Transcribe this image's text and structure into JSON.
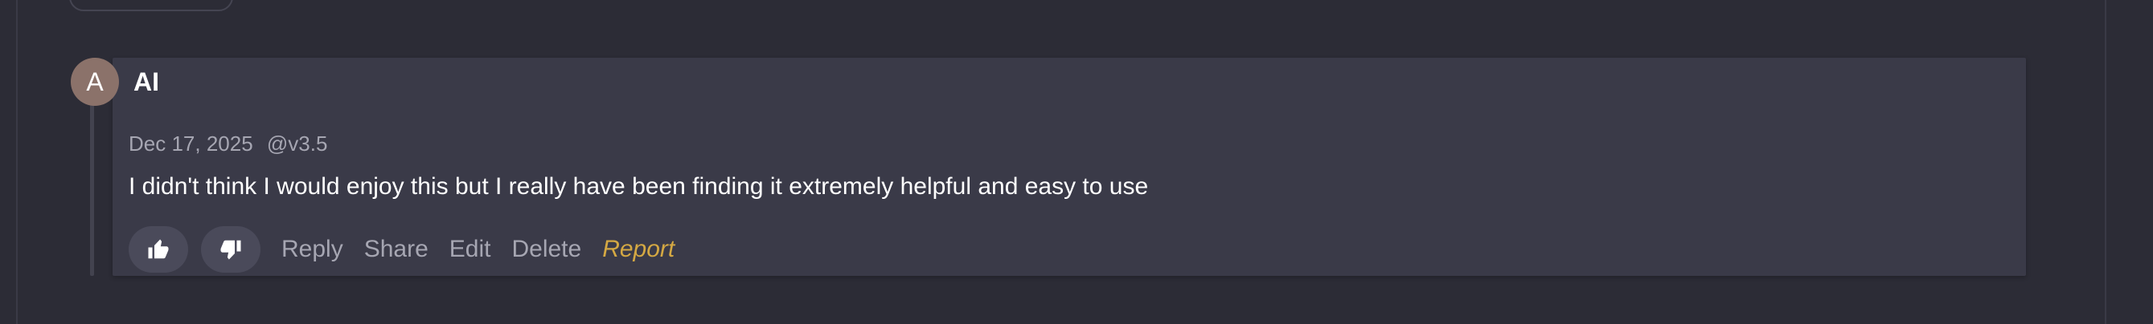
{
  "comment": {
    "avatar_initial": "A",
    "author": "AI",
    "date": "Dec 17, 2025",
    "version": "@v3.5",
    "text": "I didn't think I would enjoy this but I really have been finding it extremely helpful and easy to use",
    "like_icon": "thumbs-up-icon",
    "dislike_icon": "thumbs-down-icon",
    "actions": {
      "reply": "Reply",
      "share": "Share",
      "edit": "Edit",
      "delete": "Delete",
      "report": "Report"
    }
  },
  "colors": {
    "background": "#2c2c36",
    "card": "#3a3a48",
    "avatar": "#8b726a",
    "muted_text": "#a6a6b2",
    "report": "#d4a843"
  }
}
